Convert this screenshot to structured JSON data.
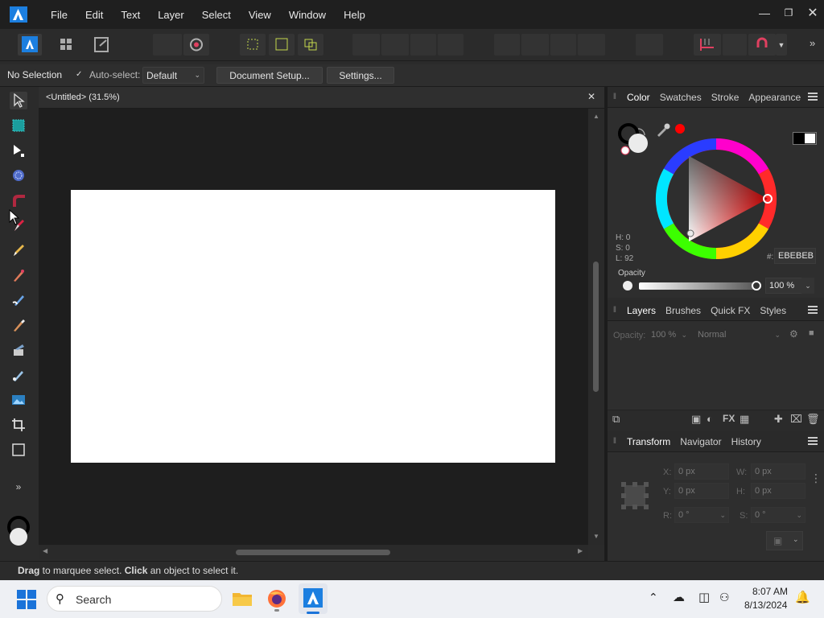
{
  "menubar": {
    "items": [
      "File",
      "Edit",
      "Text",
      "Layer",
      "Select",
      "View",
      "Window",
      "Help"
    ]
  },
  "context": {
    "selection_label": "No Selection",
    "autoselect_label": "Auto-select:",
    "autoselect_value": "Default",
    "document_setup": "Document Setup...",
    "settings": "Settings..."
  },
  "document": {
    "tab_title": "<Untitled> (31.5%)"
  },
  "color_panel": {
    "tabs": [
      "Color",
      "Swatches",
      "Stroke",
      "Appearance"
    ],
    "h_label": "H: 0",
    "s_label": "S: 0",
    "l_label": "L: 92",
    "hex_prefix": "#:",
    "hex_value": "EBEBEB",
    "opacity_label": "Opacity",
    "opacity_value": "100 %",
    "accent_color": "#ff0000"
  },
  "layers_panel": {
    "tabs": [
      "Layers",
      "Brushes",
      "Quick FX",
      "Styles"
    ],
    "opacity_label": "Opacity:",
    "opacity_value": "100 %",
    "blend_mode": "Normal"
  },
  "transform_panel": {
    "tabs": [
      "Transform",
      "Navigator",
      "History"
    ],
    "x_label": "X:",
    "x_value": "0 px",
    "y_label": "Y:",
    "y_value": "0 px",
    "w_label": "W:",
    "w_value": "0 px",
    "h_label": "H:",
    "h_value": "0 px",
    "r_label": "R:",
    "r_value": "0 °",
    "s_label": "S:",
    "s_value": "0 °"
  },
  "status": {
    "drag_bold": "Drag",
    "drag_text": " to marquee select. ",
    "click_bold": "Click",
    "click_text": " an object to select it."
  },
  "taskbar": {
    "search_placeholder": "Search",
    "time": "8:07 AM",
    "date": "8/13/2024"
  }
}
